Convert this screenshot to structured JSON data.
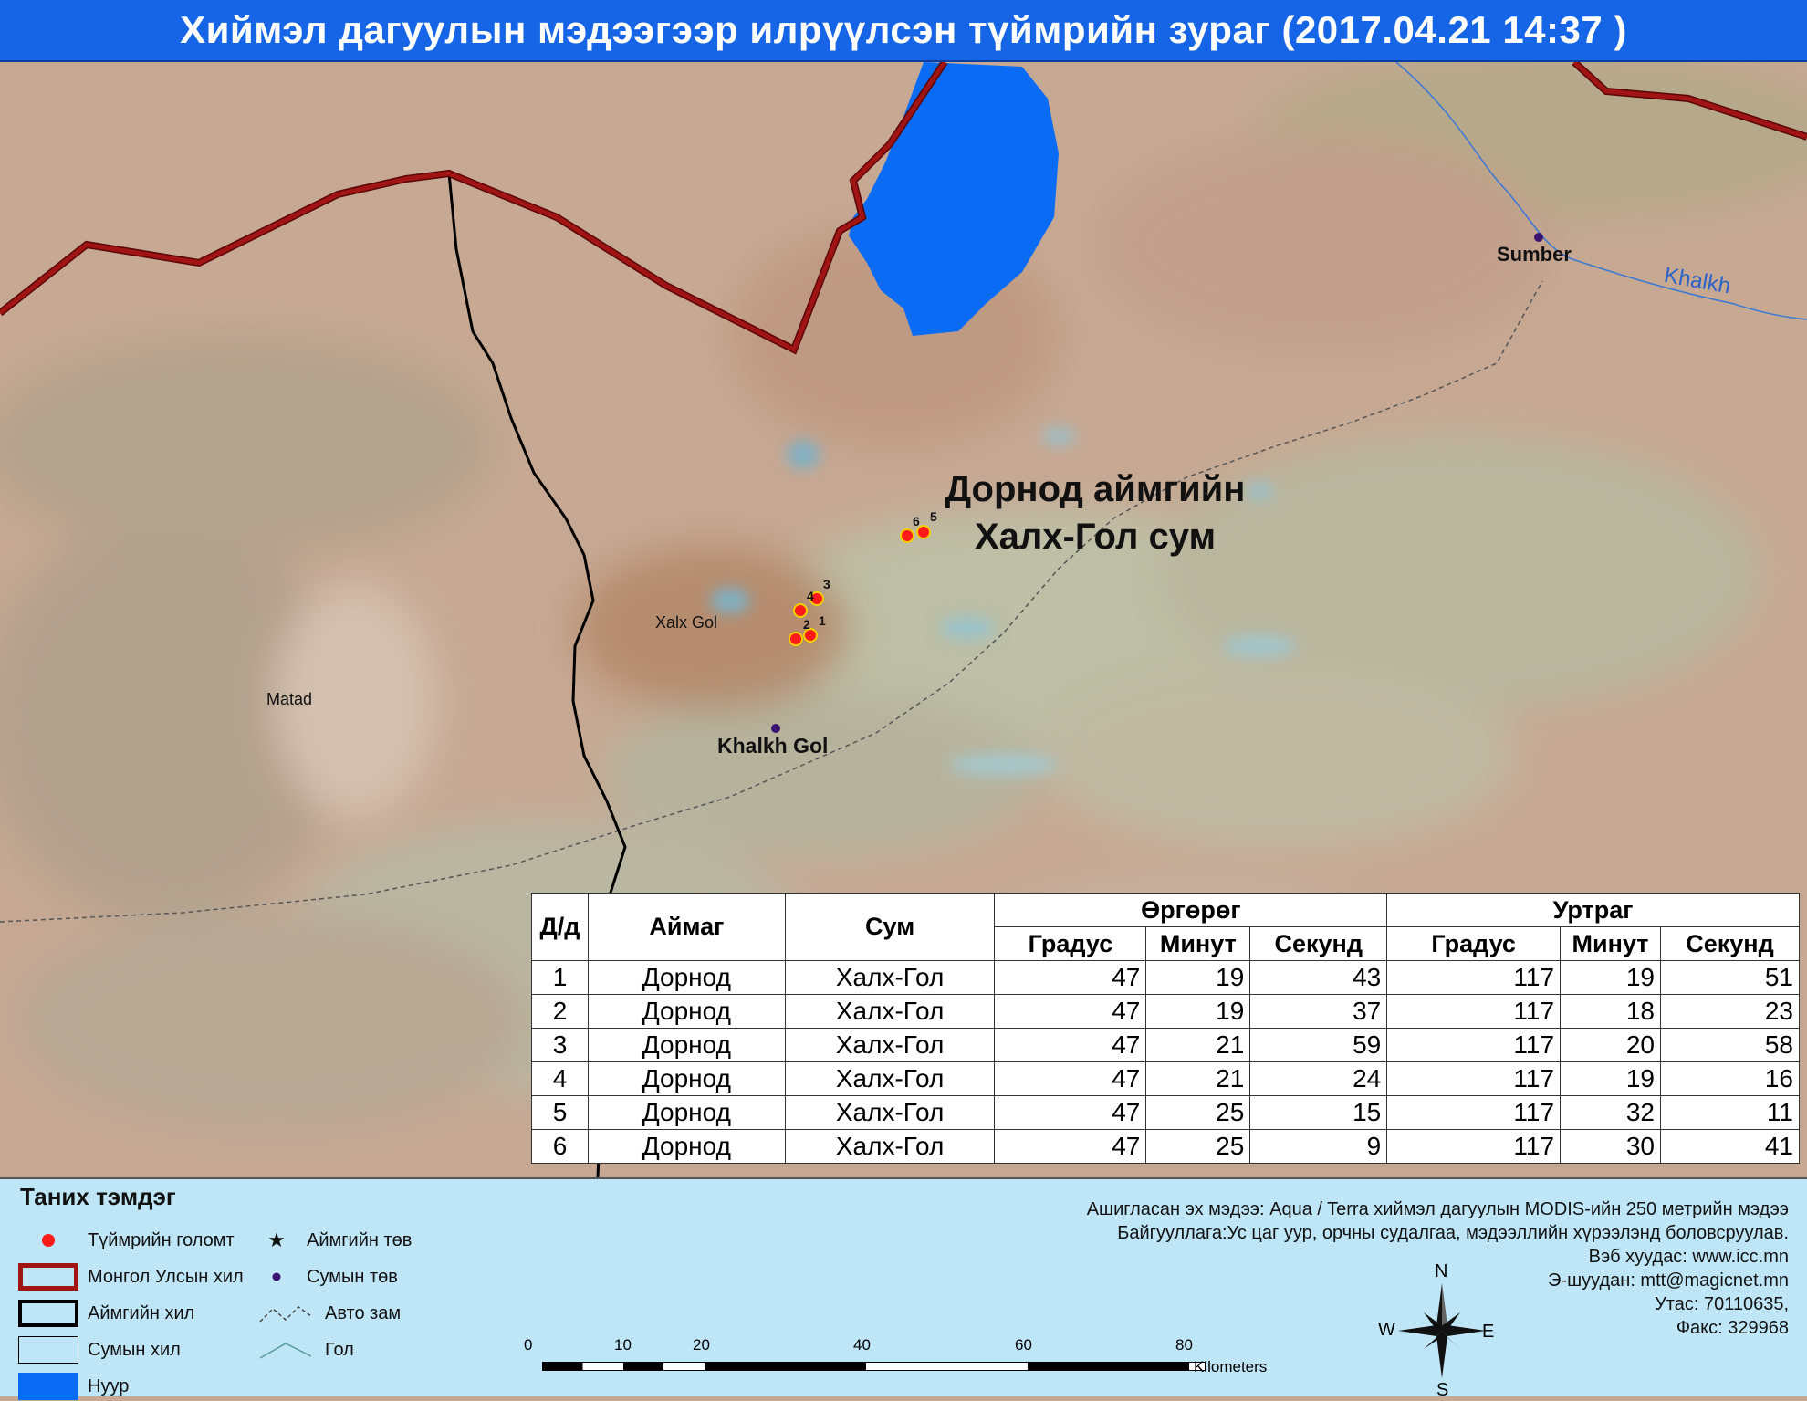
{
  "title": "Хиймэл дагуулын мэдээгээр илрүүлсэн түймрийн зураг  (2017.04.21  14:37 )",
  "map": {
    "region_label_line1": "Дорнод аймгийн",
    "region_label_line2": "Халх-Гол сум",
    "places": {
      "sumber": "Sumber",
      "khalkh_river": "Khalkh",
      "xalx_gol": "Xalx Gol",
      "matad": "Matad",
      "khalkh_gol": "Khalkh Gol"
    },
    "fire_point_labels": [
      "1",
      "2",
      "3",
      "4",
      "5",
      "6"
    ],
    "colors": {
      "lake": "#0a6cf5",
      "national_border": "#8b0b0b",
      "aimag_border": "#000000",
      "fire_point": "#ff1a1a",
      "river": "#3b78d6",
      "road": "#555555"
    }
  },
  "table": {
    "headers": {
      "no": "Д/д",
      "aimag": "Аймаг",
      "sum": "Сум",
      "latitude": "Өргөрөг",
      "longitude": "Уртраг",
      "degree": "Градус",
      "minute": "Минут",
      "second": "Секунд"
    },
    "rows": [
      {
        "no": "1",
        "aimag": "Дорнод",
        "sum": "Халх-Гол",
        "lat_d": "47",
        "lat_m": "19",
        "lat_s": "43",
        "lon_d": "117",
        "lon_m": "19",
        "lon_s": "51"
      },
      {
        "no": "2",
        "aimag": "Дорнод",
        "sum": "Халх-Гол",
        "lat_d": "47",
        "lat_m": "19",
        "lat_s": "37",
        "lon_d": "117",
        "lon_m": "18",
        "lon_s": "23"
      },
      {
        "no": "3",
        "aimag": "Дорнод",
        "sum": "Халх-Гол",
        "lat_d": "47",
        "lat_m": "21",
        "lat_s": "59",
        "lon_d": "117",
        "lon_m": "20",
        "lon_s": "58"
      },
      {
        "no": "4",
        "aimag": "Дорнод",
        "sum": "Халх-Гол",
        "lat_d": "47",
        "lat_m": "21",
        "lat_s": "24",
        "lon_d": "117",
        "lon_m": "19",
        "lon_s": "16"
      },
      {
        "no": "5",
        "aimag": "Дорнод",
        "sum": "Халх-Гол",
        "lat_d": "47",
        "lat_m": "25",
        "lat_s": "15",
        "lon_d": "117",
        "lon_m": "32",
        "lon_s": "11"
      },
      {
        "no": "6",
        "aimag": "Дорнод",
        "sum": "Халх-Гол",
        "lat_d": "47",
        "lat_m": "25",
        "lat_s": "9",
        "lon_d": "117",
        "lon_m": "30",
        "lon_s": "41"
      }
    ]
  },
  "legend": {
    "title": "Таних тэмдэг",
    "items": {
      "fire": "Түймрийн голомт",
      "national_border": "Монгол Улсын хил",
      "aimag_border": "Аймгийн хил",
      "sum_border": "Сумын хил",
      "lake": "Нуур",
      "aimag_center": "Аймгийн төв",
      "sum_center": "Сумын төв",
      "road": "Авто зам",
      "river": "Гол"
    }
  },
  "credits": [
    "Ашигласан эх мэдээ: Aqua / Terra хиймэл дагуулын MODIS-ийн 250 метрийн мэдээ",
    "Байгууллага:Ус цаг уур, орчны судалгаа, мэдээллийн хүрээлэнд боловсруулав.",
    "Вэб хуудас: www.icc.mn",
    "Э-шуудан: mtt@magicnet.mn",
    "Утас: 70110635,",
    "Факс: 329968"
  ],
  "scale_bar": {
    "ticks": [
      "0",
      "10",
      "20",
      "40",
      "60",
      "80"
    ],
    "unit": "Kilometers"
  },
  "compass": {
    "n": "N",
    "s": "S",
    "e": "E",
    "w": "W"
  }
}
